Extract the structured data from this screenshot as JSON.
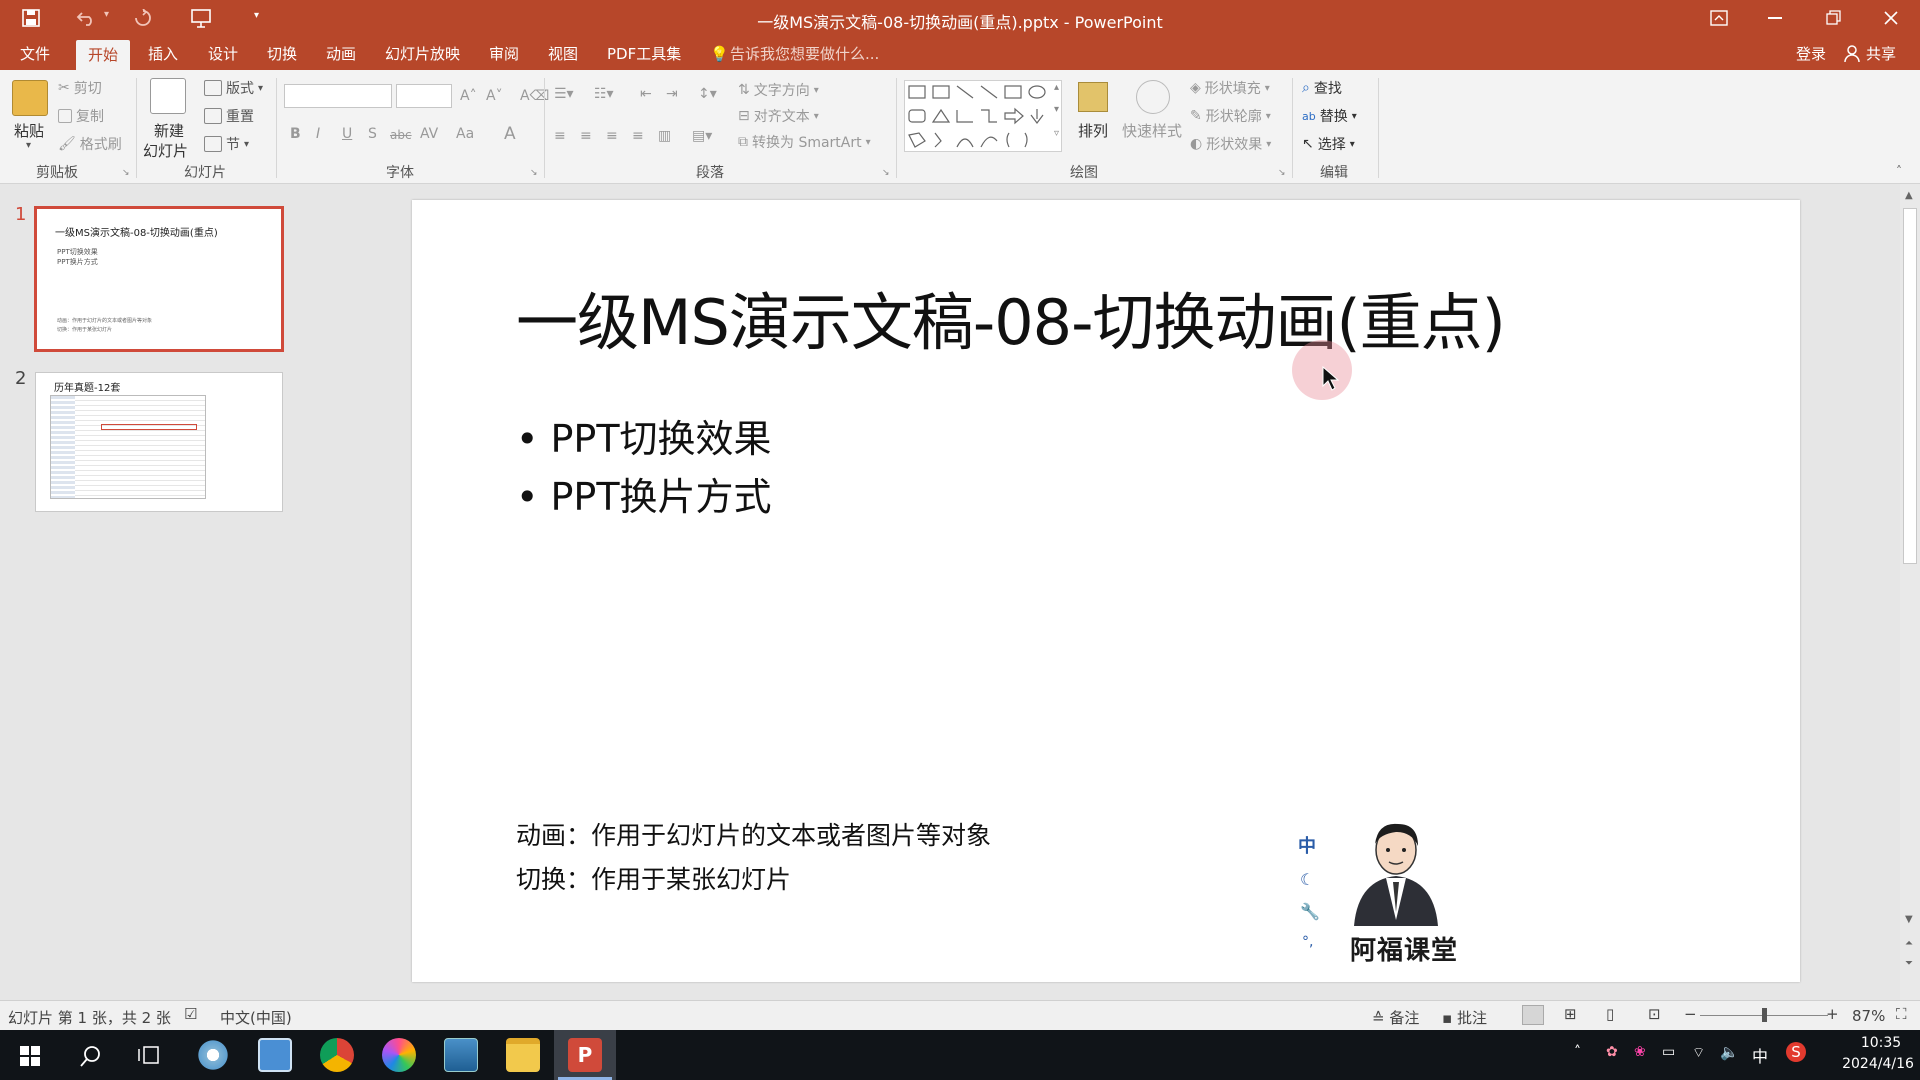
{
  "window": {
    "title": "一级MS演示文稿-08-切换动画(重点).pptx - PowerPoint"
  },
  "tabs": {
    "file": "文件",
    "home": "开始",
    "insert": "插入",
    "design": "设计",
    "transitions": "切换",
    "animations": "动画",
    "slideshow": "幻灯片放映",
    "review": "审阅",
    "view": "视图",
    "pdf": "PDF工具集",
    "tellme": "告诉我您想要做什么...",
    "login": "登录",
    "share": "共享"
  },
  "ribbon": {
    "clipboard": {
      "label": "剪贴板",
      "paste": "粘贴",
      "cut": "剪切",
      "copy": "复制",
      "format_painter": "格式刷"
    },
    "slides": {
      "label": "幻灯片",
      "new_slide_1": "新建",
      "new_slide_2": "幻灯片",
      "layout": "版式",
      "reset": "重置",
      "section": "节"
    },
    "font": {
      "label": "字体",
      "bold": "B",
      "italic": "I",
      "underline": "U",
      "shadow": "S",
      "strike": "abc",
      "spacing": "AV",
      "case": "Aa"
    },
    "paragraph": {
      "label": "段落",
      "text_direction": "文字方向",
      "align_text": "对齐文本",
      "convert_smartart": "转换为 SmartArt"
    },
    "drawing": {
      "label": "绘图",
      "arrange": "排列",
      "quick_styles": "快速样式",
      "shape_fill": "形状填充",
      "shape_outline": "形状轮廓",
      "shape_effects": "形状效果"
    },
    "editing": {
      "label": "编辑",
      "find": "查找",
      "replace": "替换",
      "select": "选择"
    }
  },
  "thumbnails": [
    {
      "number": "1",
      "title": "一级MS演示文稿-08-切换动画(重点)",
      "bullets": [
        "PPT切换效果",
        "PPT换片方式"
      ],
      "notes": [
        "动画：作用于幻灯片的文本或者图片等对象",
        "切换：作用于某张幻灯片"
      ]
    },
    {
      "number": "2",
      "title": "历年真题-12套"
    }
  ],
  "slide": {
    "title": "一级MS演示文稿-08-切换动画(重点)",
    "bullets": [
      "PPT切换效果",
      "PPT换片方式"
    ],
    "note1": "动画：作用于幻灯片的文本或者图片等对象",
    "note2": "切换：作用于某张幻灯片",
    "brand": "阿福课堂",
    "ime_glyph": "中"
  },
  "status": {
    "slide_info": "幻灯片 第 1 张，共 2 张",
    "language": "中文(中国)",
    "notes": "备注",
    "comments": "批注",
    "zoom": "87%",
    "zoom_fraction": 0.5
  },
  "taskbar": {
    "time": "10:35",
    "date": "2024/4/16",
    "ime": "中"
  },
  "colors": {
    "accent": "#b7472a",
    "selection": "#d04a3a"
  }
}
